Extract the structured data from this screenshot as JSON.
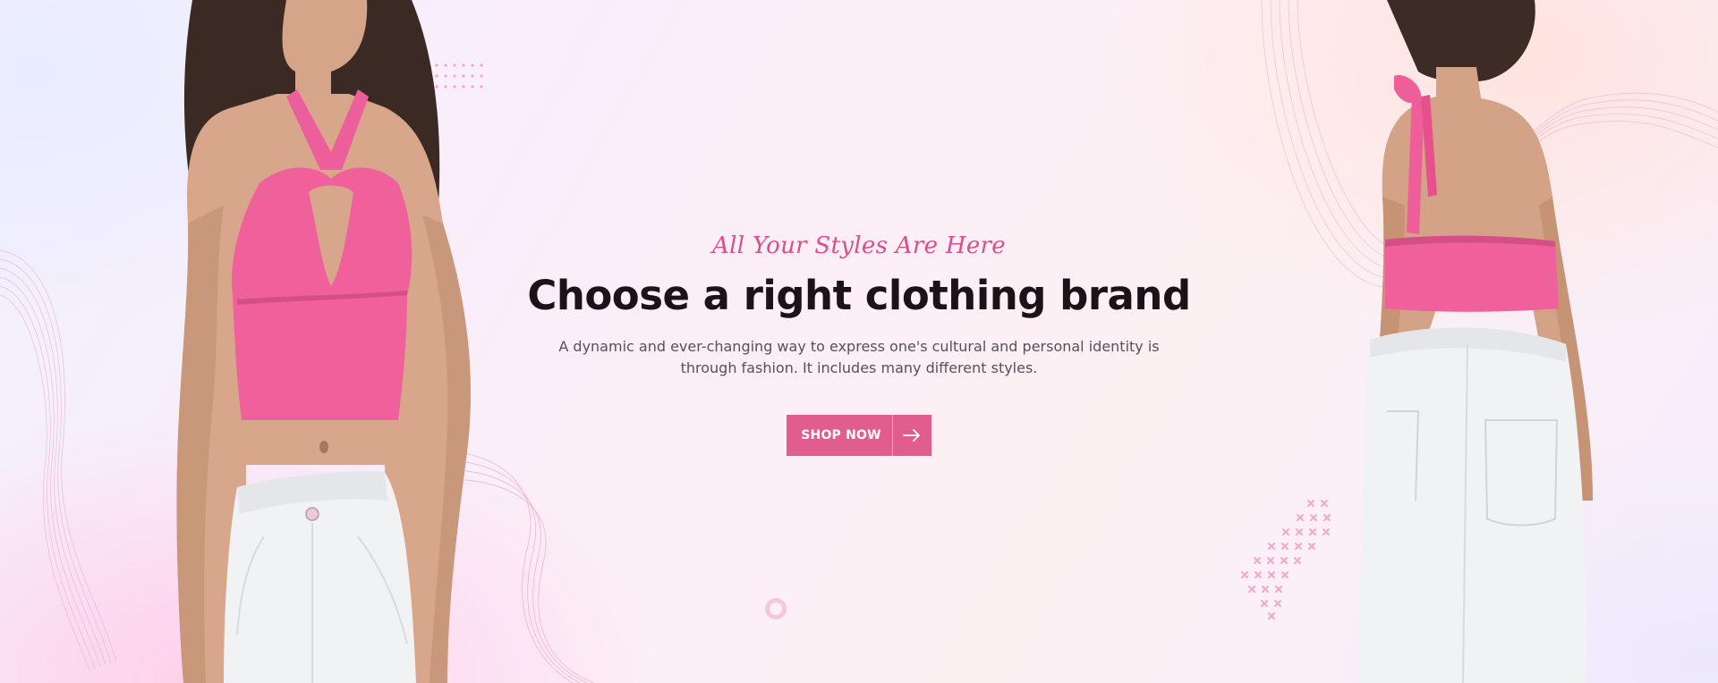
{
  "hero": {
    "tagline": "All Your Styles Are Here",
    "headline": "Choose a right clothing brand",
    "description": "A dynamic and ever-changing way to express one's cultural and personal identity is through fashion. It includes many different styles.",
    "cta": {
      "label": "SHOP NOW",
      "icon": "arrow-right-icon"
    }
  },
  "images": {
    "left_model": "model-front-pink-halter-top-white-jeans",
    "right_model": "model-back-pink-halter-top-white-jeans"
  },
  "colors": {
    "accent": "#e05d8e",
    "tagline": "#d94f8c",
    "headline": "#1c1318",
    "body_text": "#55505a",
    "top_pink": "#f0609b",
    "jeans_white": "#f1f2f4"
  }
}
